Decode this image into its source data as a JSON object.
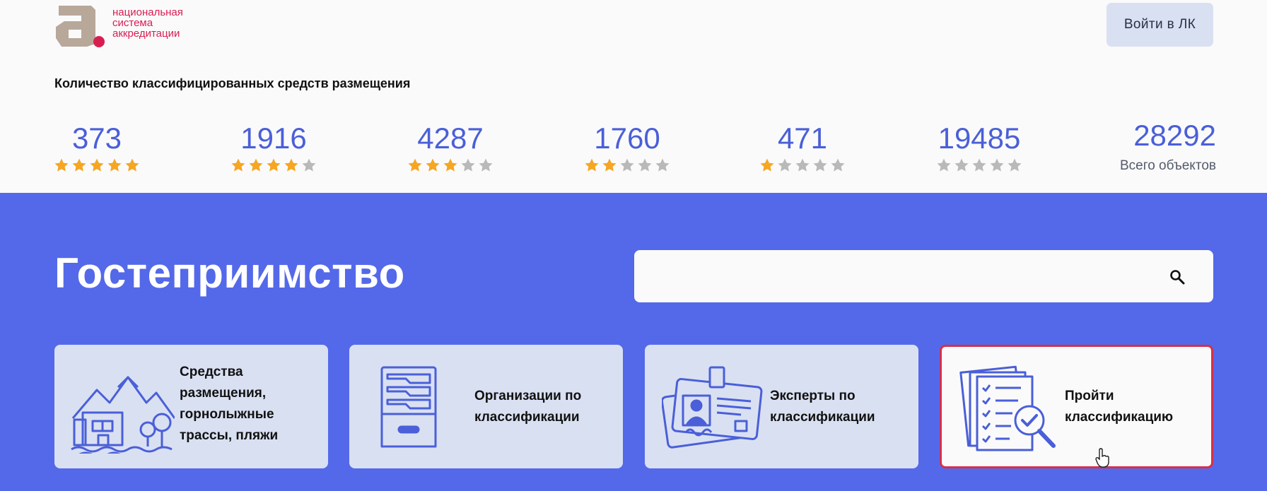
{
  "header": {
    "logo_lines": [
      "национальная",
      "система",
      "аккредитации"
    ],
    "login_label": "Войти в ЛК"
  },
  "stats": {
    "title": "Количество классифицированных средств размещения",
    "items": [
      {
        "value": "373",
        "stars": 5
      },
      {
        "value": "1916",
        "stars": 4
      },
      {
        "value": "4287",
        "stars": 3
      },
      {
        "value": "1760",
        "stars": 2
      },
      {
        "value": "471",
        "stars": 1
      },
      {
        "value": "19485",
        "stars": 0
      }
    ],
    "total_value": "28292",
    "total_label": "Всего объектов"
  },
  "hero": {
    "title": "Гостеприимство",
    "search_placeholder": ""
  },
  "cards": [
    {
      "label": "Средства размещения, горнолыжные трассы, пляжи",
      "icon": "resort-icon"
    },
    {
      "label": "Организации по классификации",
      "icon": "file-cabinet-icon"
    },
    {
      "label": "Эксперты по классификации",
      "icon": "id-badge-icon"
    },
    {
      "label": "Пройти классификацию",
      "icon": "checklist-magnifier-icon"
    }
  ],
  "colors": {
    "accent": "#5469e9",
    "number": "#4a5fd8",
    "star_on": "#f5a623",
    "star_off": "#b9b9b9",
    "brand": "#d81e50"
  }
}
